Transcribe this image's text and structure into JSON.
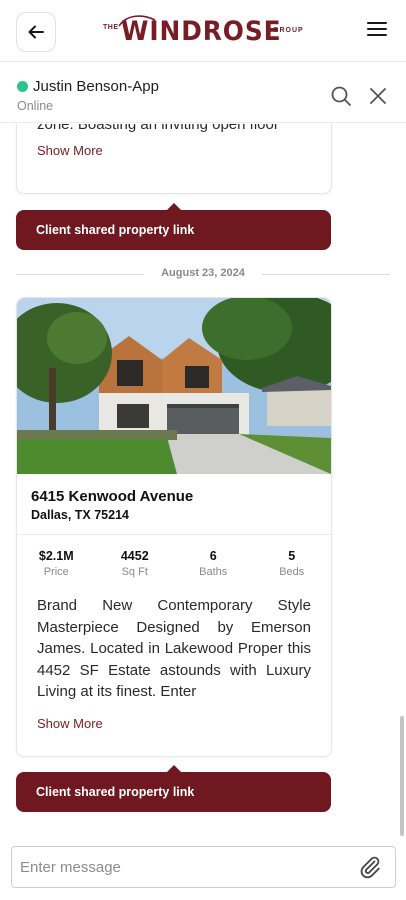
{
  "header": {
    "logo_the": "THE",
    "logo_brand": "WINDROSE",
    "logo_group": "GROUP",
    "back_icon": "arrow-left-icon",
    "menu_icon": "hamburger-menu-icon",
    "brand_color": "#7a1c24"
  },
  "chat": {
    "contact_name": "Justin Benson-App",
    "status": "Online",
    "status_color": "#2bc48a",
    "search_icon": "search-icon",
    "close_icon": "close-icon"
  },
  "messages": {
    "first_card": {
      "description_tail": "zone. Boasting an inviting open floor",
      "show_more": "Show More"
    },
    "banner_1": "Client shared property link",
    "date_separator": "August 23, 2024",
    "property": {
      "address_line1": "6415 Kenwood Avenue",
      "address_line2": "Dallas, TX 75214",
      "stats": [
        {
          "value": "$2.1M",
          "label": "Price"
        },
        {
          "value": "4452",
          "label": "Sq Ft"
        },
        {
          "value": "6",
          "label": "Baths"
        },
        {
          "value": "5",
          "label": "Beds"
        }
      ],
      "description": "Brand New Contemporary Style Masterpiece Designed by Emerson James. Located in Lakewood Proper this 4452 SF Estate astounds with Luxury Living at its finest. Enter",
      "show_more": "Show More"
    },
    "banner_2": "Client shared property link"
  },
  "composer": {
    "placeholder": "Enter message",
    "attach_icon": "paperclip-icon"
  }
}
